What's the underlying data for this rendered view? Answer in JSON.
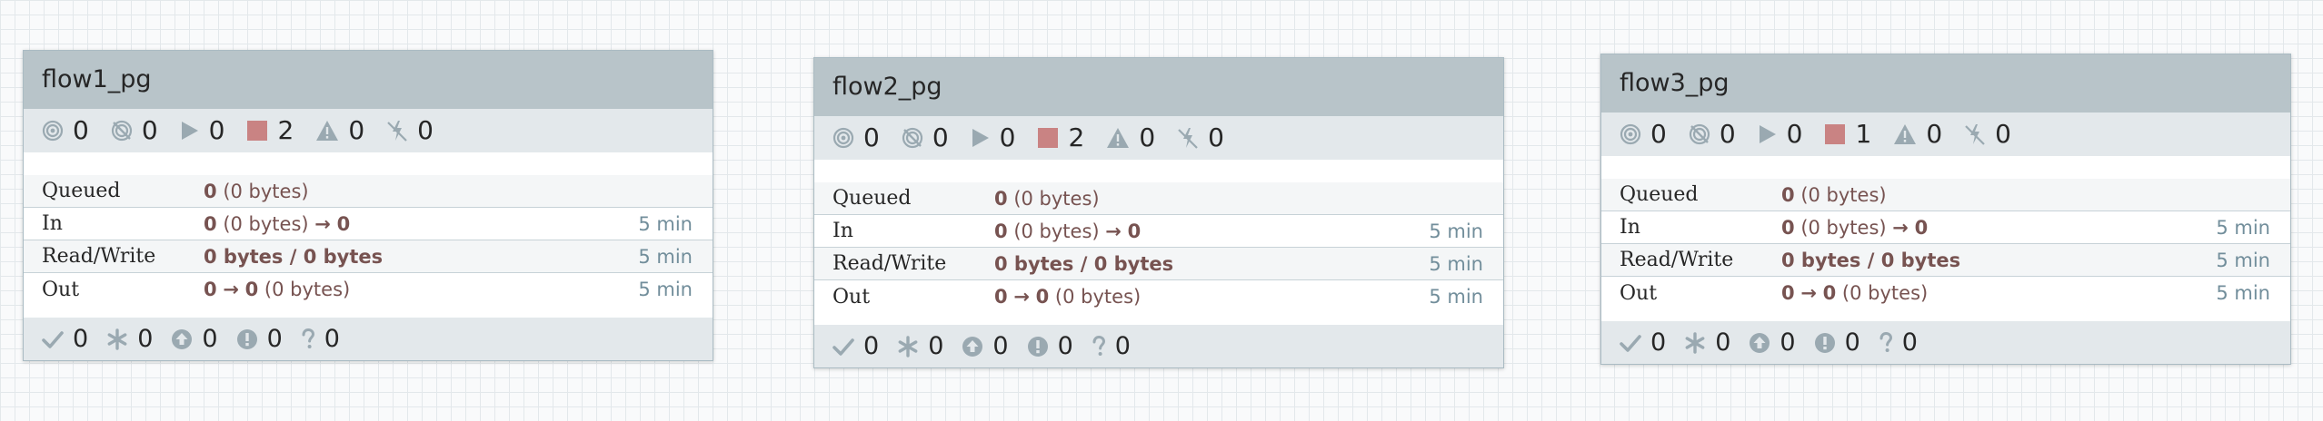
{
  "process_groups": [
    {
      "name": "flow1_pg",
      "status": {
        "transmitting": "0",
        "not_transmitting": "0",
        "running": "0",
        "stopped": "2",
        "invalid": "0",
        "disabled": "0"
      },
      "stats": {
        "queued": {
          "label": "Queued",
          "count": "0",
          "size": "(0 bytes)"
        },
        "in": {
          "label": "In",
          "count": "0",
          "size": "(0 bytes)",
          "arrow": "→",
          "out_count": "0",
          "time": "5 min"
        },
        "read_write": {
          "label": "Read/Write",
          "value": "0 bytes / 0 bytes",
          "time": "5 min"
        },
        "out": {
          "label": "Out",
          "count": "0",
          "arrow": "→",
          "out_count": "0",
          "size": "(0 bytes)",
          "time": "5 min"
        }
      },
      "versioning": {
        "up_to_date": "0",
        "locally_modified": "0",
        "stale": "0",
        "locally_modified_stale": "0",
        "sync_failure": "0"
      }
    },
    {
      "name": "flow2_pg",
      "status": {
        "transmitting": "0",
        "not_transmitting": "0",
        "running": "0",
        "stopped": "2",
        "invalid": "0",
        "disabled": "0"
      },
      "stats": {
        "queued": {
          "label": "Queued",
          "count": "0",
          "size": "(0 bytes)"
        },
        "in": {
          "label": "In",
          "count": "0",
          "size": "(0 bytes)",
          "arrow": "→",
          "out_count": "0",
          "time": "5 min"
        },
        "read_write": {
          "label": "Read/Write",
          "value": "0 bytes / 0 bytes",
          "time": "5 min"
        },
        "out": {
          "label": "Out",
          "count": "0",
          "arrow": "→",
          "out_count": "0",
          "size": "(0 bytes)",
          "time": "5 min"
        }
      },
      "versioning": {
        "up_to_date": "0",
        "locally_modified": "0",
        "stale": "0",
        "locally_modified_stale": "0",
        "sync_failure": "0"
      }
    },
    {
      "name": "flow3_pg",
      "status": {
        "transmitting": "0",
        "not_transmitting": "0",
        "running": "0",
        "stopped": "1",
        "invalid": "0",
        "disabled": "0"
      },
      "stats": {
        "queued": {
          "label": "Queued",
          "count": "0",
          "size": "(0 bytes)"
        },
        "in": {
          "label": "In",
          "count": "0",
          "size": "(0 bytes)",
          "arrow": "→",
          "out_count": "0",
          "time": "5 min"
        },
        "read_write": {
          "label": "Read/Write",
          "value": "0 bytes / 0 bytes",
          "time": "5 min"
        },
        "out": {
          "label": "Out",
          "count": "0",
          "arrow": "→",
          "out_count": "0",
          "size": "(0 bytes)",
          "time": "5 min"
        }
      },
      "versioning": {
        "up_to_date": "0",
        "locally_modified": "0",
        "stale": "0",
        "locally_modified_stale": "0",
        "sync_failure": "0"
      }
    }
  ],
  "icons": {
    "transmitting": "transmitting-icon",
    "not_transmitting": "not-transmitting-icon",
    "running": "play-icon",
    "stopped": "stop-icon",
    "invalid": "warning-icon",
    "disabled": "disabled-icon",
    "up_to_date": "check-icon",
    "locally_modified": "asterisk-icon",
    "stale": "arrow-up-circle-icon",
    "locally_modified_stale": "exclamation-circle-icon",
    "sync_failure": "question-icon"
  },
  "colors": {
    "header_bg": "#b8c4c9",
    "status_bar_bg": "#e3e8eb",
    "icon_gray": "#9aa9b1",
    "stopped_red": "#c98383",
    "value_brown": "#775351",
    "time_blue": "#728e9b"
  }
}
